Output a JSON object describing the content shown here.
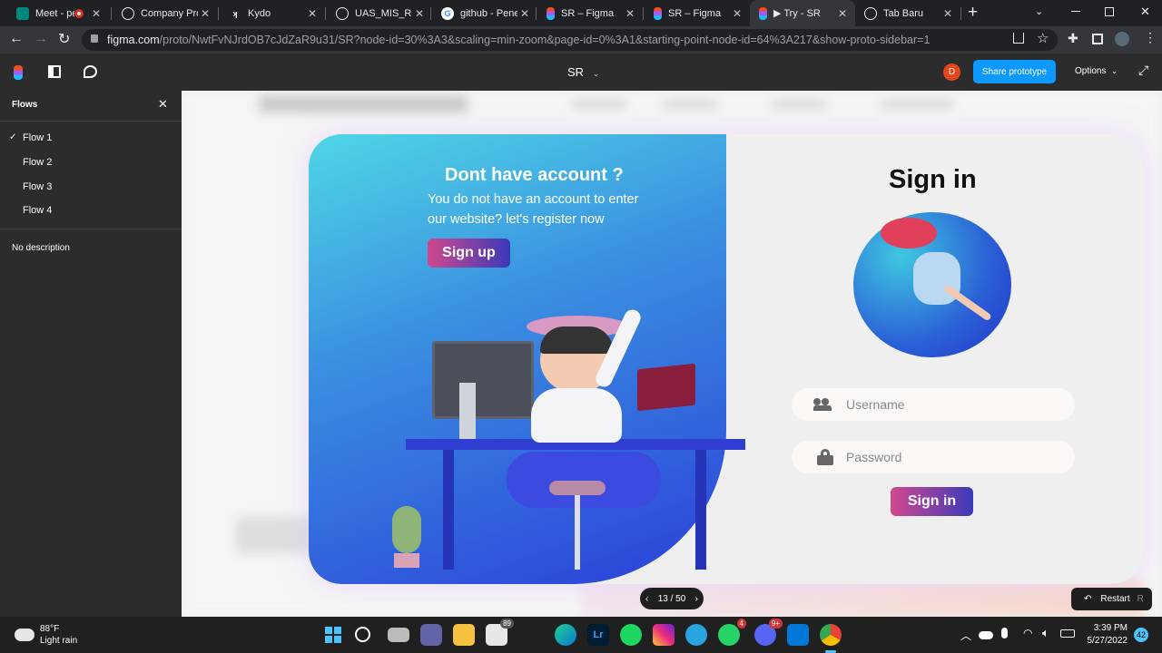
{
  "tabs": [
    {
      "label": "Meet - pe",
      "icon": "google-meet-icon",
      "color": "#00897b"
    },
    {
      "label": "Company Prof",
      "icon": "globe-icon",
      "color": "#5f6368"
    },
    {
      "label": "Kydo",
      "icon": "kydo-icon",
      "color": "#3a3a3a"
    },
    {
      "label": "UAS_MIS_Reta",
      "icon": "globe-icon",
      "color": "#5f6368"
    },
    {
      "label": "github - Peneli",
      "icon": "google-icon",
      "color": "#4285f4"
    },
    {
      "label": "SR – Figma",
      "icon": "figma-icon",
      "color": "#f24e1e"
    },
    {
      "label": "SR – Figma",
      "icon": "figma-icon",
      "color": "#f24e1e"
    },
    {
      "label": "▶ Try - SR",
      "icon": "figma-icon",
      "color": "#f24e1e"
    },
    {
      "label": "Tab Baru",
      "icon": "chrome-icon",
      "color": "#5f6368"
    }
  ],
  "browser": {
    "url_host": "figma.com",
    "url_path": "/proto/NwtFvNJrdOB7cJdZaR9u31/SR?node-id=30%3A3&scaling=min-zoom&page-id=0%3A1&starting-point-node-id=64%3A217&show-proto-sidebar=1"
  },
  "figma": {
    "file_name": "SR",
    "avatar_letter": "D",
    "share_label": "Share prototype",
    "options_label": "Options",
    "accent": "#0d99ff"
  },
  "sidebar": {
    "title": "Flows",
    "flows": [
      {
        "label": "Flow 1",
        "checked": "✓"
      },
      {
        "label": "Flow 2",
        "checked": ""
      },
      {
        "label": "Flow 3",
        "checked": ""
      },
      {
        "label": "Flow 4",
        "checked": ""
      }
    ],
    "description": "No description"
  },
  "card": {
    "left_title": "Dont have account ?",
    "left_text_1": "You do not have an account to enter",
    "left_text_2": "our website? let's register now",
    "signup_label": "Sign up",
    "right_title": "Sign in",
    "username_placeholder": "Username",
    "password_placeholder": "Password",
    "signin_label": "Sign in"
  },
  "pager": {
    "label": "13 / 50"
  },
  "restart": {
    "label": "Restart",
    "key": "R"
  },
  "taskbar": {
    "weather_temp": "88°F",
    "weather_desc": "Light rain",
    "time": "3:39 PM",
    "date": "5/27/2022",
    "notif_count": "42",
    "badges": {
      "store": "89",
      "whatsapp": "4",
      "discord": "9+"
    }
  }
}
